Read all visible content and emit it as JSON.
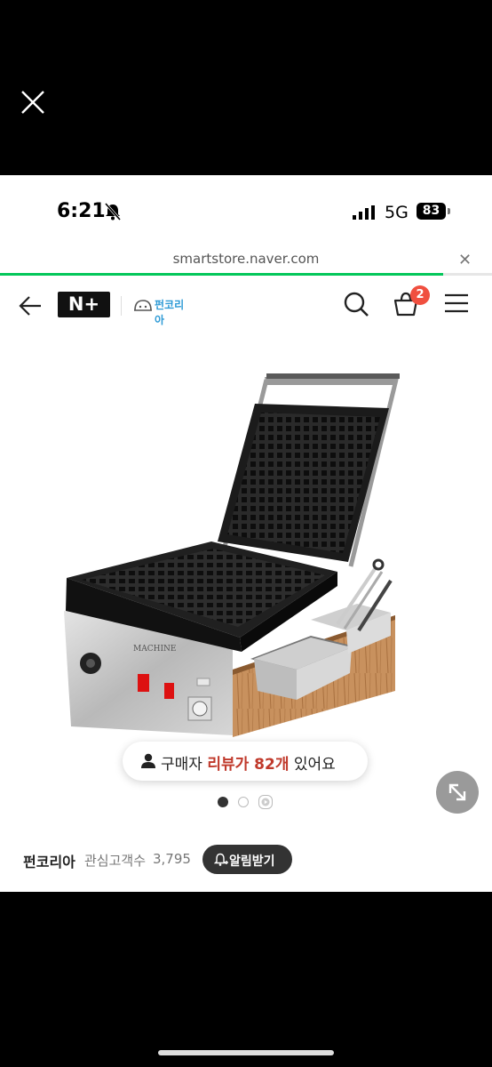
{
  "status_bar": {
    "time": "6:21",
    "network": "5G",
    "battery": "83"
  },
  "browser": {
    "url": "smartstore.naver.com",
    "load_progress": 0.9,
    "accent_color": "#03c75a"
  },
  "header": {
    "nplus_label": "N+",
    "store_logo_text": "펀코리아",
    "cart_count": "2",
    "icons": [
      "back-arrow-icon",
      "search-icon",
      "cart-icon",
      "menu-icon"
    ]
  },
  "product": {
    "image_alt": "waffle machine product photo",
    "review_pill": {
      "prefix": "구매자 ",
      "highlight": "리뷰가 82개",
      "suffix": " 있어요",
      "highlight_color": "#c0392b"
    },
    "carousel": {
      "total": 3,
      "active": 1
    }
  },
  "store": {
    "name": "펀코리아",
    "fans_label": "관심고객수",
    "fans_count": "3,795",
    "alarm_button": "알림받기"
  }
}
